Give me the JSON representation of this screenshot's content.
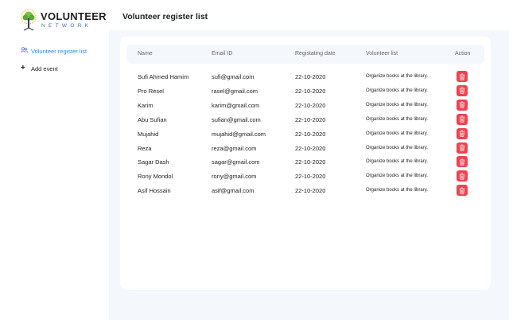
{
  "brand": {
    "title": "VOLUNTEER",
    "subtitle": "NETWORK"
  },
  "sidebar": {
    "items": [
      {
        "label": "Volunteer register list",
        "icon": "users-icon",
        "active": true
      },
      {
        "label": "Add event",
        "icon": "plus-icon",
        "active": false
      }
    ]
  },
  "page": {
    "title": "Volunteer register list"
  },
  "table": {
    "headers": [
      "Name",
      "Email ID",
      "Registating date",
      "Volunteer list",
      "Action"
    ],
    "rows": [
      {
        "name": "Sufi Ahmed Hamim",
        "email": "sufi@gmail.com",
        "date": "22-10-2020",
        "task": "Organize books at the library."
      },
      {
        "name": "Pro Resel",
        "email": "rasel@gmail.com",
        "date": "22-10-2020",
        "task": "Organize books at the library."
      },
      {
        "name": "Karim",
        "email": "karim@gmail.com",
        "date": "22-10-2020",
        "task": "Organize books at the library."
      },
      {
        "name": "Abu Sufian",
        "email": "sufian@gmail.com",
        "date": "22-10-2020",
        "task": "Organize books at the library."
      },
      {
        "name": "Mujahid",
        "email": "mujahid@gmail.com",
        "date": "22-10-2020",
        "task": "Organize books at the library."
      },
      {
        "name": "Reza",
        "email": "reza@gmail.com",
        "date": "22-10-2020",
        "task": "Organize books at the library."
      },
      {
        "name": "Sagar Dash",
        "email": "sagar@gmail.com",
        "date": "22-10-2020",
        "task": "Organize books at the library."
      },
      {
        "name": "Rony Mondol",
        "email": "rony@gmail.com",
        "date": "22-10-2020",
        "task": "Organize books at the library."
      },
      {
        "name": "Asif Hossain",
        "email": "asif@gmail.com",
        "date": "22-10-2020",
        "task": "Organize books at the library."
      }
    ],
    "action_icon": "trash-icon"
  },
  "colors": {
    "accent": "#2e86e8",
    "danger": "#ef4350",
    "background": "#f4f7fc"
  }
}
